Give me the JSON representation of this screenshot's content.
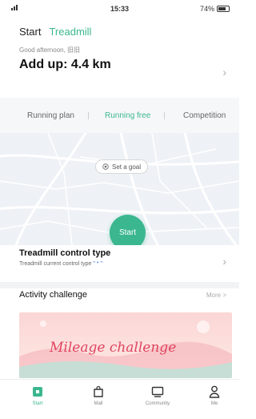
{
  "status_bar": {
    "time": "15:33",
    "battery": "74%"
  },
  "top_tabs": [
    {
      "label": "Start",
      "active": false
    },
    {
      "label": "Treadmill",
      "active": true
    }
  ],
  "greeting": "Good afternoon, 旧旧",
  "summary": {
    "label": "Add up: 4.4 km"
  },
  "modes": [
    {
      "label": "Running plan",
      "active": false
    },
    {
      "label": "Running free",
      "active": true
    },
    {
      "label": "Competition",
      "active": false
    }
  ],
  "goal_button": {
    "label": "Set a goal",
    "icon": "target-icon"
  },
  "start_button": {
    "label": "Start"
  },
  "control": {
    "title": "Treadmill control type",
    "subtitle": "Treadmill current control type",
    "value": "\" * \""
  },
  "activity": {
    "title": "Activity challenge",
    "more": "More >"
  },
  "banner": {
    "label": "Mileage challenge"
  },
  "bottom_tabs": [
    {
      "label": "Start",
      "icon": "start-icon",
      "active": true
    },
    {
      "label": "Mall",
      "icon": "bag-icon",
      "active": false
    },
    {
      "label": "Community",
      "icon": "monitor-icon",
      "active": false
    },
    {
      "label": "Me",
      "icon": "person-icon",
      "active": false
    }
  ],
  "colors": {
    "accent": "#3bb78f",
    "banner_text": "#e0445f",
    "control_value": "#2e6de0"
  }
}
